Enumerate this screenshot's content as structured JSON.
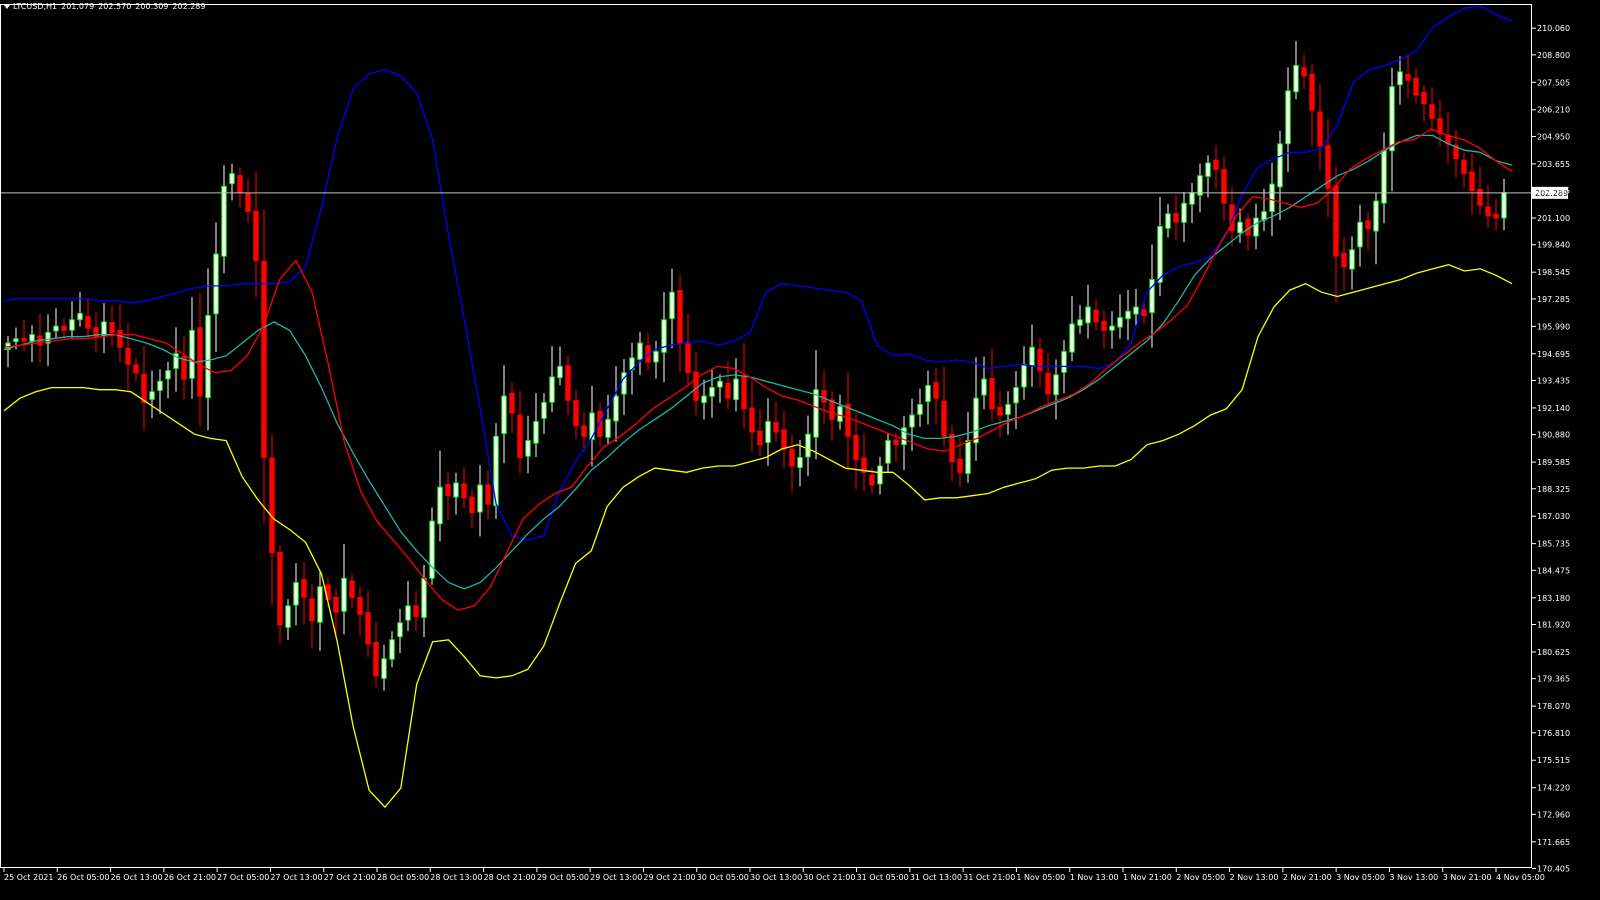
{
  "header": {
    "symbol": "LTCUSD,H1",
    "open": "201.079",
    "high": "202.570",
    "low": "200.309",
    "close": "202.289"
  },
  "colors": {
    "background": "#000000",
    "axis": "#ffffff",
    "bull_candle": "#00ff00",
    "bull_body": "#ffffff",
    "bear_candle": "#ff0000",
    "bb_upper": "#0000ff",
    "bb_lower": "#ffff00",
    "ma_fast": "#ff0000",
    "ma_slow": "#20b2aa",
    "price_line": "#c0c0c0"
  },
  "chart_data": {
    "type": "candlestick",
    "symbol": "LTCUSD",
    "timeframe": "H1",
    "current_price": 202.289,
    "current_price_label": "202.289",
    "ylim": [
      170.43,
      211.2
    ],
    "y_ticks": [
      "210.060",
      "208.800",
      "207.505",
      "206.210",
      "204.950",
      "203.655",
      "202.395",
      "201.100",
      "199.840",
      "198.545",
      "197.285",
      "195.990",
      "194.695",
      "193.435",
      "192.140",
      "190.880",
      "189.585",
      "188.325",
      "187.030",
      "185.735",
      "184.475",
      "183.180",
      "181.920",
      "180.625",
      "179.365",
      "178.070",
      "176.810",
      "175.515",
      "174.220",
      "172.960",
      "171.665",
      "170.405"
    ],
    "x_ticks": [
      "25 Oct 2021",
      "26 Oct 05:00",
      "26 Oct 13:00",
      "26 Oct 21:00",
      "27 Oct 05:00",
      "27 Oct 13:00",
      "27 Oct 21:00",
      "28 Oct 05:00",
      "28 Oct 13:00",
      "28 Oct 21:00",
      "29 Oct 05:00",
      "29 Oct 13:00",
      "29 Oct 21:00",
      "30 Oct 05:00",
      "30 Oct 13:00",
      "30 Oct 21:00",
      "31 Oct 05:00",
      "31 Oct 13:00",
      "31 Oct 21:00",
      "1 Nov 05:00",
      "1 Nov 13:00",
      "1 Nov 21:00",
      "2 Nov 05:00",
      "2 Nov 13:00",
      "2 Nov 21:00",
      "3 Nov 05:00",
      "3 Nov 13:00",
      "3 Nov 21:00",
      "4 Nov 05:00"
    ],
    "closes": [
      195.2,
      195.4,
      195.3,
      195.6,
      195.1,
      195.7,
      196.0,
      195.8,
      196.3,
      196.6,
      195.9,
      195.5,
      196.2,
      195.7,
      195.0,
      194.2,
      193.8,
      192.4,
      192.9,
      193.4,
      193.9,
      194.7,
      193.5,
      195.8,
      192.7,
      196.5,
      199.4,
      202.6,
      203.2,
      202.3,
      201.4,
      199.1,
      189.8,
      185.3,
      181.9,
      182.8,
      183.9,
      183.2,
      182.1,
      183.7,
      183.1,
      182.5,
      184.1,
      183.2,
      182.4,
      181.0,
      179.5,
      180.3,
      181.2,
      182.0,
      182.8,
      182.3,
      184.1,
      186.8,
      188.4,
      188.0,
      188.6,
      187.9,
      187.2,
      188.5,
      187.6,
      190.8,
      192.7,
      191.9,
      189.8,
      190.6,
      191.5,
      192.4,
      193.6,
      194.1,
      192.5,
      191.3,
      190.8,
      191.9,
      190.8,
      191.6,
      192.7,
      193.8,
      194.5,
      195.2,
      194.3,
      194.8,
      196.3,
      197.6,
      195.2,
      193.8,
      192.5,
      192.7,
      193.1,
      193.4,
      192.6,
      193.5,
      192.1,
      191.0,
      190.4,
      191.5,
      191.0,
      190.2,
      189.4,
      189.8,
      190.9,
      193.0,
      192.4,
      191.6,
      192.2,
      190.8,
      189.7,
      189.1,
      188.5,
      189.4,
      190.6,
      190.4,
      191.2,
      191.8,
      192.3,
      193.2,
      192.6,
      190.8,
      189.6,
      189.1,
      190.6,
      192.6,
      193.5,
      192.1,
      191.8,
      192.3,
      193.1,
      194.2,
      195.0,
      193.9,
      192.8,
      193.7,
      194.8,
      196.1,
      196.3,
      196.9,
      196.2,
      195.8,
      196.0,
      196.4,
      196.7,
      196.9,
      196.5,
      198.2,
      200.7,
      201.3,
      200.9,
      201.8,
      202.3,
      203.1,
      203.7,
      203.4,
      201.8,
      200.5,
      200.9,
      200.3,
      201.1,
      201.4,
      202.7,
      204.6,
      207.1,
      208.3,
      207.8,
      206.2,
      204.5,
      202.5,
      199.3,
      198.8,
      199.6,
      200.9,
      200.6,
      201.9,
      204.3,
      207.3,
      208.0,
      207.6,
      206.9,
      206.5,
      205.8,
      205.1,
      204.6,
      203.9,
      203.2,
      202.4,
      201.7,
      201.2,
      201.1,
      202.3
    ],
    "bb_upper": [
      197.2,
      197.3,
      197.3,
      197.3,
      197.3,
      197.3,
      197.2,
      197.2,
      197.1,
      197.2,
      197.4,
      197.6,
      197.8,
      197.9,
      197.9,
      198.0,
      198.0,
      198.0,
      198.1,
      198.8,
      201.6,
      204.9,
      207.2,
      207.9,
      208.1,
      207.8,
      207.0,
      204.8,
      200.3,
      196.3,
      192.1,
      187.6,
      186.1,
      185.9,
      186.1,
      188.2,
      189.6,
      190.7,
      192.1,
      193.5,
      194.3,
      194.9,
      195.1,
      195.2,
      195.3,
      195.1,
      195.3,
      195.7,
      197.6,
      198.0,
      197.9,
      197.8,
      197.7,
      197.6,
      197.2,
      195.1,
      194.6,
      194.7,
      194.4,
      194.3,
      194.4,
      194.3,
      194.0,
      194.1,
      194.2,
      194.1,
      194.1,
      194.1,
      194.1,
      194.0,
      194.3,
      195.2,
      197.6,
      198.4,
      198.8,
      199.0,
      199.3,
      200.3,
      202.2,
      203.5,
      203.9,
      204.2,
      204.2,
      204.4,
      205.5,
      207.5,
      208.1,
      208.3,
      208.6,
      209.0,
      210.1,
      210.6,
      211.0,
      211.1,
      210.7,
      210.4
    ],
    "bb_lower": [
      192.0,
      192.6,
      192.9,
      193.1,
      193.1,
      193.1,
      193.0,
      193.0,
      192.9,
      192.4,
      191.9,
      191.4,
      190.9,
      190.7,
      190.6,
      188.9,
      187.8,
      186.9,
      186.4,
      185.8,
      184.3,
      181.1,
      177.1,
      174.1,
      173.3,
      174.2,
      179.1,
      181.1,
      181.2,
      180.4,
      179.5,
      179.4,
      179.5,
      179.8,
      180.9,
      182.9,
      184.8,
      185.4,
      187.5,
      188.4,
      188.9,
      189.3,
      189.2,
      189.1,
      189.3,
      189.4,
      189.4,
      189.6,
      189.8,
      190.2,
      190.4,
      190.1,
      189.7,
      189.3,
      189.2,
      189.1,
      189.1,
      188.5,
      187.8,
      187.9,
      187.9,
      188.0,
      188.1,
      188.4,
      188.6,
      188.8,
      189.2,
      189.3,
      189.3,
      189.4,
      189.4,
      189.7,
      190.4,
      190.6,
      190.9,
      191.3,
      191.8,
      192.1,
      193.0,
      195.5,
      196.9,
      197.7,
      198.0,
      197.6,
      197.4,
      197.6,
      197.8,
      198.0,
      198.2,
      198.5,
      198.7,
      198.9,
      198.6,
      198.7,
      198.4,
      198.0
    ],
    "ma_fast": [
      195.0,
      195.1,
      195.2,
      195.3,
      195.4,
      195.4,
      195.5,
      195.6,
      195.6,
      195.4,
      195.2,
      194.7,
      194.2,
      193.8,
      193.9,
      194.6,
      196.0,
      198.2,
      199.1,
      197.6,
      194.2,
      190.5,
      188.2,
      186.8,
      185.9,
      185.0,
      184.0,
      183.1,
      182.6,
      182.8,
      183.7,
      185.3,
      186.9,
      187.6,
      188.1,
      188.4,
      189.4,
      190.3,
      190.8,
      191.4,
      192.1,
      192.6,
      193.1,
      193.7,
      194.1,
      194.0,
      193.6,
      193.1,
      192.7,
      192.5,
      192.2,
      191.9,
      191.7,
      191.4,
      191.1,
      190.8,
      190.5,
      190.2,
      190.1,
      190.4,
      190.7,
      191.1,
      191.5,
      191.8,
      192.2,
      192.5,
      192.8,
      193.3,
      194.0,
      194.6,
      195.2,
      195.7,
      196.3,
      197.0,
      198.4,
      199.9,
      201.2,
      202.1,
      202.0,
      201.8,
      201.6,
      201.8,
      202.5,
      203.4,
      203.9,
      204.3,
      204.7,
      204.8,
      205.3,
      205.0,
      204.8,
      204.4,
      203.8,
      203.3
    ],
    "ma_slow": [
      194.9,
      195.1,
      195.3,
      195.4,
      195.5,
      195.5,
      195.6,
      195.6,
      195.4,
      195.2,
      194.9,
      194.5,
      194.3,
      194.4,
      194.6,
      195.2,
      195.8,
      196.2,
      195.8,
      194.6,
      193.1,
      191.4,
      190.0,
      188.7,
      187.5,
      186.3,
      185.4,
      184.6,
      183.9,
      183.6,
      183.9,
      184.6,
      185.4,
      186.2,
      186.9,
      187.5,
      188.3,
      189.2,
      189.8,
      190.5,
      191.1,
      191.6,
      192.1,
      192.7,
      193.3,
      193.6,
      193.7,
      193.6,
      193.4,
      193.2,
      193.0,
      192.8,
      192.5,
      192.2,
      191.9,
      191.6,
      191.3,
      190.9,
      190.7,
      190.7,
      190.8,
      191.0,
      191.3,
      191.5,
      191.7,
      192.0,
      192.3,
      192.6,
      193.0,
      193.5,
      194.1,
      194.7,
      195.3,
      196.1,
      197.2,
      198.4,
      199.2,
      199.8,
      200.4,
      200.9,
      201.2,
      201.6,
      202.1,
      202.6,
      203.1,
      203.4,
      203.8,
      204.3,
      204.7,
      205.0,
      205.0,
      204.6,
      204.3,
      204.2,
      203.8,
      203.6
    ]
  }
}
